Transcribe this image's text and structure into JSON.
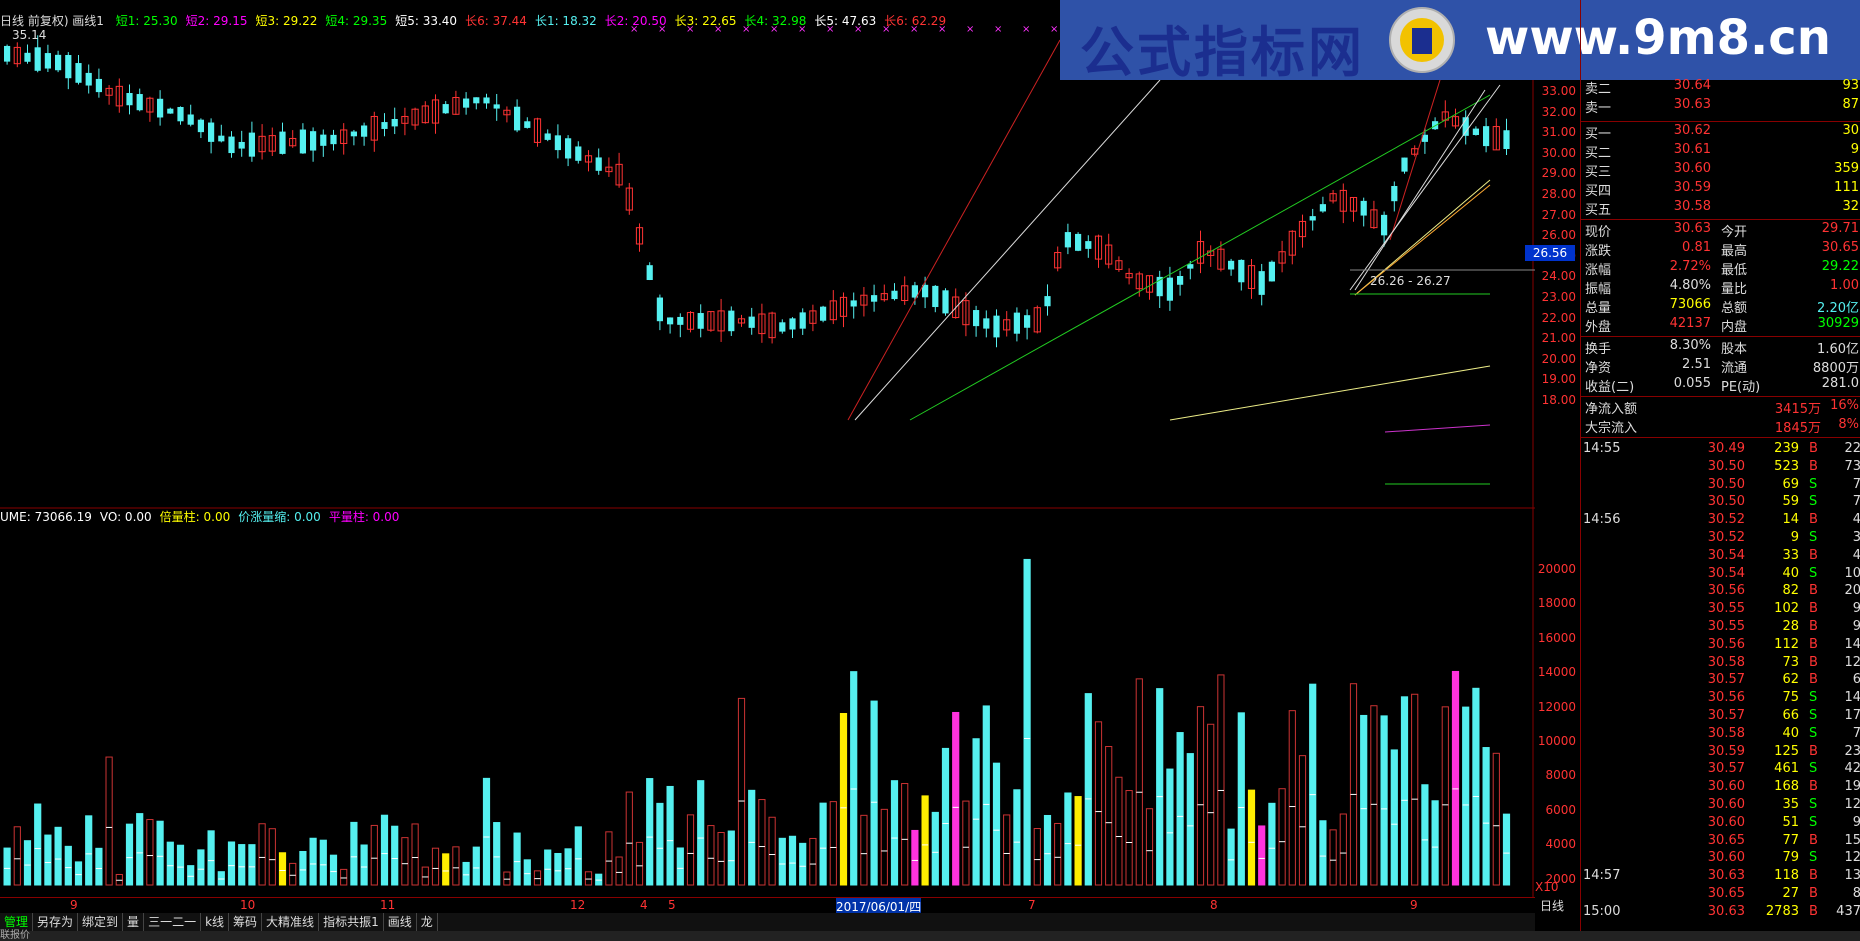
{
  "colors": {
    "up": "#ff3333",
    "down": "#55f0f0",
    "bg": "#000000",
    "grid": "#800000"
  },
  "header": {
    "title": "日线 前复权) 画线1",
    "ma_items": [
      {
        "label": "短1: 25.30",
        "color": "#00ff00"
      },
      {
        "label": "短2: 29.15",
        "color": "#ff00ff"
      },
      {
        "label": "短3: 29.22",
        "color": "#ffff00"
      },
      {
        "label": "短4: 29.35",
        "color": "#00ff00"
      },
      {
        "label": "短5: 33.40",
        "color": "#ffffff"
      },
      {
        "label": "长6: 37.44",
        "color": "#ff3333"
      },
      {
        "label": "长1: 18.32",
        "color": "#55f0f0"
      },
      {
        "label": "长2: 20.50",
        "color": "#ff00ff"
      },
      {
        "label": "长3: 22.65",
        "color": "#ffff00"
      },
      {
        "label": "长4: 32.98",
        "color": "#00ff00"
      },
      {
        "label": "长5: 47.63",
        "color": "#ffffff"
      },
      {
        "label": "长6: 62.29",
        "color": "#ff3333"
      }
    ],
    "high_label": "35.14"
  },
  "banner": {
    "cn": "公式指标网",
    "url": "www.9m8.cn"
  },
  "price_axis": [
    "33.00",
    "32.00",
    "31.00",
    "30.00",
    "29.00",
    "28.00",
    "27.00",
    "26.00",
    "25.00",
    "24.00",
    "23.00",
    "22.00",
    "21.00",
    "20.00",
    "19.00",
    "18.00"
  ],
  "price_flag": "26.56",
  "range_note": "26.26 - 26.27",
  "volume_header": {
    "items": [
      {
        "label": "UME: 73066.19",
        "color": "#ffffff"
      },
      {
        "label": "VO: 0.00",
        "color": "#ffffff"
      },
      {
        "label": "倍量柱: 0.00",
        "color": "#ffff00"
      },
      {
        "label": "价涨量缩: 0.00",
        "color": "#55f0f0"
      },
      {
        "label": "平量柱: 0.00",
        "color": "#ff00ff"
      }
    ]
  },
  "vol_axis": [
    "20000",
    "18000",
    "16000",
    "14000",
    "12000",
    "10000",
    "8000",
    "6000",
    "4000",
    "2000"
  ],
  "vol_unit": "X10",
  "date_axis": [
    {
      "label": "9",
      "pos": 70
    },
    {
      "label": "10",
      "pos": 240
    },
    {
      "label": "11",
      "pos": 380
    },
    {
      "label": "12",
      "pos": 570
    },
    {
      "label": "4",
      "pos": 640
    },
    {
      "label": "5",
      "pos": 668
    },
    {
      "label": "2017/06/01/四",
      "pos": 836
    },
    {
      "label": "7",
      "pos": 1028
    },
    {
      "label": "8",
      "pos": 1210
    },
    {
      "label": "9",
      "pos": 1410
    }
  ],
  "period_label": "日线",
  "tabs": [
    {
      "label": "管理",
      "active": true
    },
    {
      "label": "另存为",
      "active": false
    },
    {
      "label": "绑定到",
      "active": false
    },
    {
      "label": "量",
      "active": false
    },
    {
      "label": "三一二一",
      "active": false
    },
    {
      "label": "k线",
      "active": false
    },
    {
      "label": "筹码",
      "active": false
    },
    {
      "label": "大精准线",
      "active": false
    },
    {
      "label": "指标共振1",
      "active": false
    },
    {
      "label": "画线",
      "active": false
    },
    {
      "label": "龙",
      "active": false
    }
  ],
  "side": {
    "asks": [
      {
        "label": "卖二",
        "price": "30.64",
        "vol": "93"
      },
      {
        "label": "卖一",
        "price": "30.63",
        "vol": "87"
      }
    ],
    "bids": [
      {
        "label": "买一",
        "price": "30.62",
        "vol": "30"
      },
      {
        "label": "买二",
        "price": "30.61",
        "vol": "9"
      },
      {
        "label": "买三",
        "price": "30.60",
        "vol": "359"
      },
      {
        "label": "买四",
        "price": "30.59",
        "vol": "111"
      },
      {
        "label": "买五",
        "price": "30.58",
        "vol": "32"
      }
    ],
    "stats": [
      {
        "l1": "现价",
        "v1": "30.63",
        "l2": "今开",
        "v2": "29.71",
        "c1": "#ff3333",
        "c2": "#ff3333"
      },
      {
        "l1": "涨跌",
        "v1": "0.81",
        "l2": "最高",
        "v2": "30.65",
        "c1": "#ff3333",
        "c2": "#ff3333"
      },
      {
        "l1": "涨幅",
        "v1": "2.72%",
        "l2": "最低",
        "v2": "29.22",
        "c1": "#ff3333",
        "c2": "#00ff00"
      },
      {
        "l1": "振幅",
        "v1": "4.80%",
        "l2": "量比",
        "v2": "1.00",
        "c1": "#dddddd",
        "c2": "#ff3333"
      },
      {
        "l1": "总量",
        "v1": "73066",
        "l2": "总额",
        "v2": "2.20亿",
        "c1": "#ffff00",
        "c2": "#55f0f0"
      },
      {
        "l1": "外盘",
        "v1": "42137",
        "l2": "内盘",
        "v2": "30929",
        "c1": "#ff3333",
        "c2": "#00ff00"
      }
    ],
    "stats2": [
      {
        "l1": "换手",
        "v1": "8.30%",
        "l2": "股本",
        "v2": "1.60亿"
      },
      {
        "l1": "净资",
        "v1": "2.51",
        "l2": "流通",
        "v2": "8800万"
      },
      {
        "l1": "收益(二)",
        "v1": "0.055",
        "l2": "PE(动)",
        "v2": "281.0"
      }
    ],
    "flows": [
      {
        "label": "净流入额",
        "value": "3415万",
        "pct": "16%"
      },
      {
        "label": "大宗流入",
        "value": "1845万",
        "pct": "8%"
      }
    ],
    "ticks": [
      {
        "t": "14:55",
        "p": "30.49",
        "q": "239",
        "f": "B",
        "n": "22"
      },
      {
        "t": "",
        "p": "30.50",
        "q": "523",
        "f": "B",
        "n": "73"
      },
      {
        "t": "",
        "p": "30.50",
        "q": "69",
        "f": "S",
        "n": "7"
      },
      {
        "t": "",
        "p": "30.50",
        "q": "59",
        "f": "S",
        "n": "7"
      },
      {
        "t": "14:56",
        "p": "30.52",
        "q": "14",
        "f": "B",
        "n": "4"
      },
      {
        "t": "",
        "p": "30.52",
        "q": "9",
        "f": "S",
        "n": "3"
      },
      {
        "t": "",
        "p": "30.54",
        "q": "33",
        "f": "B",
        "n": "4"
      },
      {
        "t": "",
        "p": "30.54",
        "q": "40",
        "f": "S",
        "n": "10"
      },
      {
        "t": "",
        "p": "30.56",
        "q": "82",
        "f": "B",
        "n": "20"
      },
      {
        "t": "",
        "p": "30.55",
        "q": "102",
        "f": "B",
        "n": "9"
      },
      {
        "t": "",
        "p": "30.55",
        "q": "28",
        "f": "B",
        "n": "9"
      },
      {
        "t": "",
        "p": "30.56",
        "q": "112",
        "f": "B",
        "n": "14"
      },
      {
        "t": "",
        "p": "30.58",
        "q": "73",
        "f": "B",
        "n": "12"
      },
      {
        "t": "",
        "p": "30.57",
        "q": "62",
        "f": "B",
        "n": "6"
      },
      {
        "t": "",
        "p": "30.56",
        "q": "75",
        "f": "S",
        "n": "14"
      },
      {
        "t": "",
        "p": "30.57",
        "q": "66",
        "f": "S",
        "n": "17"
      },
      {
        "t": "",
        "p": "30.58",
        "q": "40",
        "f": "S",
        "n": "7"
      },
      {
        "t": "",
        "p": "30.59",
        "q": "125",
        "f": "B",
        "n": "23"
      },
      {
        "t": "",
        "p": "30.57",
        "q": "461",
        "f": "S",
        "n": "42"
      },
      {
        "t": "",
        "p": "30.60",
        "q": "168",
        "f": "B",
        "n": "19"
      },
      {
        "t": "",
        "p": "30.60",
        "q": "35",
        "f": "S",
        "n": "12"
      },
      {
        "t": "",
        "p": "30.60",
        "q": "51",
        "f": "S",
        "n": "9"
      },
      {
        "t": "",
        "p": "30.65",
        "q": "77",
        "f": "B",
        "n": "15"
      },
      {
        "t": "",
        "p": "30.60",
        "q": "79",
        "f": "S",
        "n": "12"
      },
      {
        "t": "14:57",
        "p": "30.63",
        "q": "118",
        "f": "B",
        "n": "13"
      },
      {
        "t": "",
        "p": "30.65",
        "q": "27",
        "f": "B",
        "n": "8"
      },
      {
        "t": "15:00",
        "p": "30.63",
        "q": "2783",
        "f": "B",
        "n": "437"
      }
    ]
  },
  "bottom_status": "联报价"
}
